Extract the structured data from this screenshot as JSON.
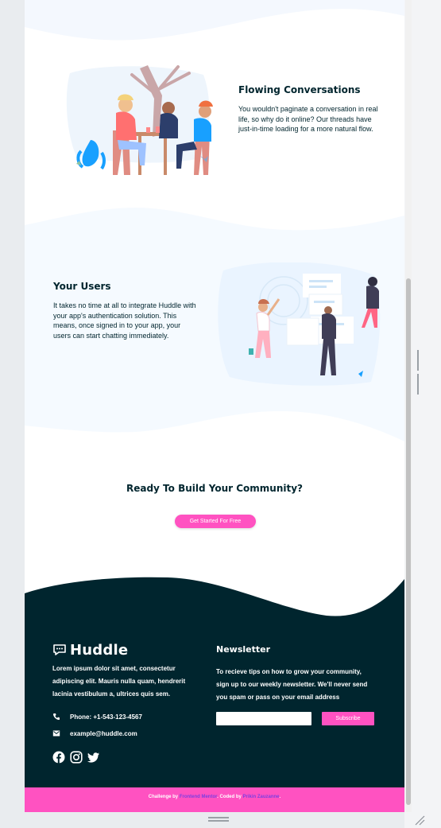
{
  "section_flow": {
    "title": "Flowing Conversations",
    "text": "You wouldn't paginate a conversation in real life, so why do it online? Our threads have just-in-time loading for a more natural flow."
  },
  "section_users": {
    "title": "Your Users",
    "text": "It takes no time at all to integrate Huddle with your app's authentication solution. This means, once signed in to your app, your users can start chatting immediately."
  },
  "cta": {
    "title": "Ready To Build Your Community?",
    "button": "Get Started For Free"
  },
  "footer": {
    "brand": "Huddle",
    "about": "Lorem ipsum dolor sit amet, consectetur adipiscing elit. Mauris nulla quam, hendrerit lacinia vestibulum a, ultrices quis sem.",
    "phone": "Phone: +1-543-123-4567",
    "email": "example@huddle.com",
    "newsletter_title": "Newsletter",
    "newsletter_text": "To recieve tips on how to grow your community, sign up to our weekly newsletter. We'll never send you spam or pass on your email address",
    "input_value": "",
    "subscribe": "Subscribe",
    "social_icons": [
      "facebook-icon",
      "instagram-icon",
      "twitter-icon"
    ]
  },
  "attribution": {
    "prefix": "Challenge by ",
    "link1": "Frontend Mentor",
    "middle": ". Coded by ",
    "link2": "Prikin Zauzanne",
    "suffix": "."
  },
  "colors": {
    "dark": "#00252e",
    "pink": "#ff52c1",
    "light_blue": "#f5faff",
    "link_purple": "#7b3fe0"
  }
}
